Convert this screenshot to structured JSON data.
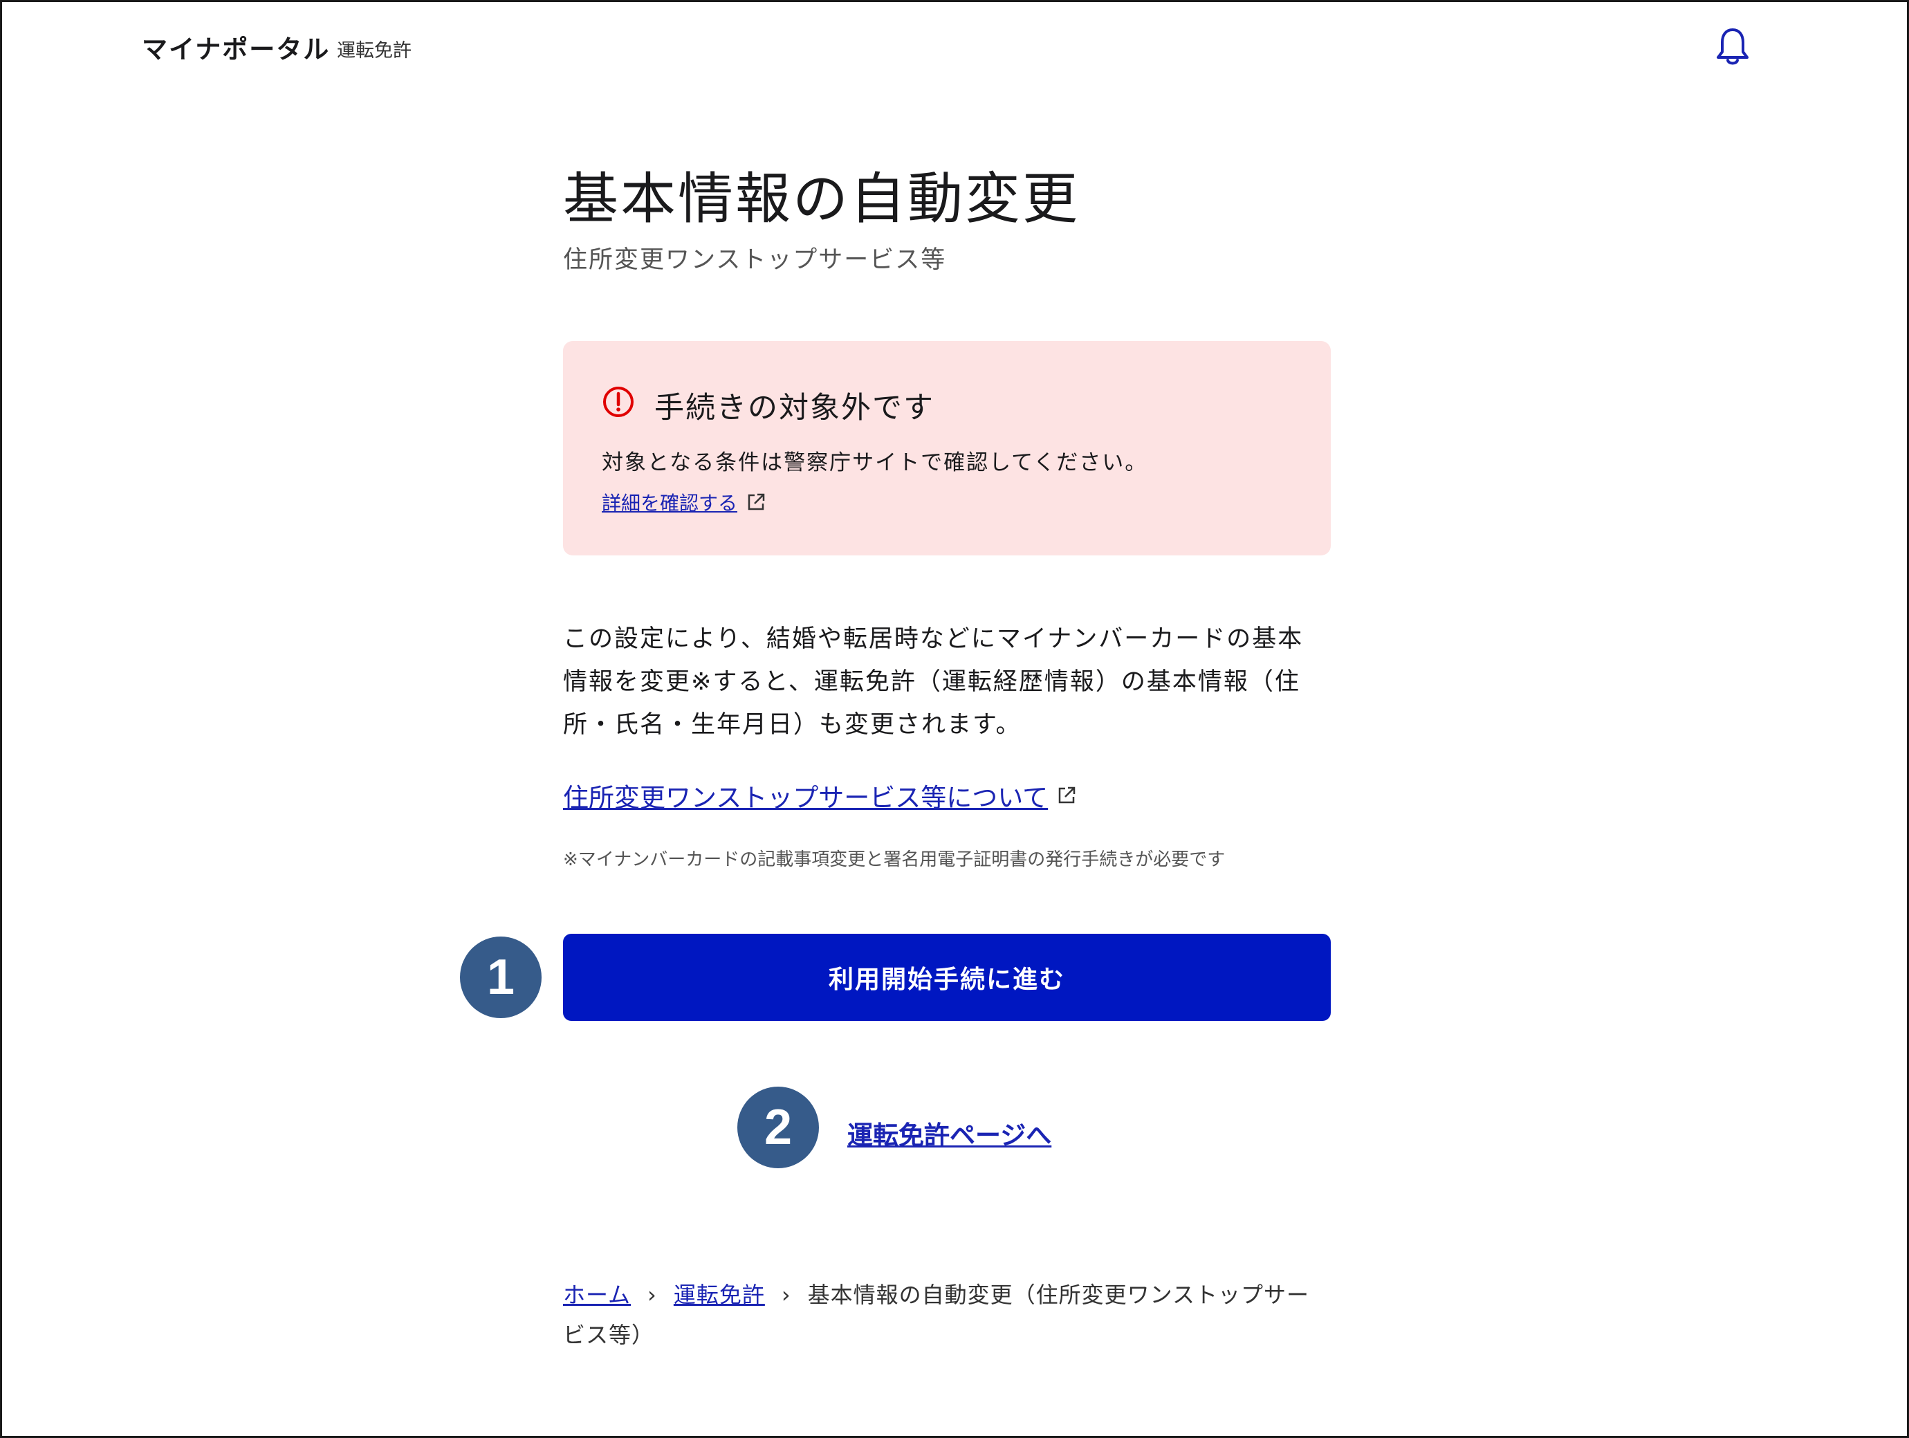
{
  "header": {
    "brand": "マイナポータル",
    "section": "運転免許",
    "icons": {
      "notifications": "bell-icon"
    }
  },
  "page": {
    "title": "基本情報の自動変更",
    "subtitle": "住所変更ワンストップサービス等"
  },
  "alert": {
    "icon": "alert-circle-icon",
    "title": "手続きの対象外です",
    "body": "対象となる条件は警察庁サイトで確認してください。",
    "link": "詳細を確認する",
    "background": "#fde3e3",
    "icon_color": "#e00000"
  },
  "description": {
    "lines": [
      "この設定により、結婚や転居時などにマイナンバーカードの基本",
      "情報を変更※すると、運転免許（運転経歴情報）の基本情報（住",
      "所・氏名・生年月日）も変更されます。"
    ],
    "link": "住所変更ワンストップサービス等について",
    "note": "※マイナンバーカードの記載事項変更と署名用電子証明書の発行手続きが必要です"
  },
  "actions": {
    "primary_label": "利用開始手続に進む",
    "back_link": "運転免許ページへ",
    "primary_color": "#0017c1"
  },
  "breadcrumb": {
    "items": [
      "ホーム",
      "運転免許"
    ],
    "current_line1": "基本情報の自動変更（住所変更ワンストップサー",
    "current_line2": "ビス等）",
    "separator": "›"
  },
  "annotations": {
    "badge1": "1",
    "badge2": "2",
    "badge_color": "#365b8a"
  }
}
